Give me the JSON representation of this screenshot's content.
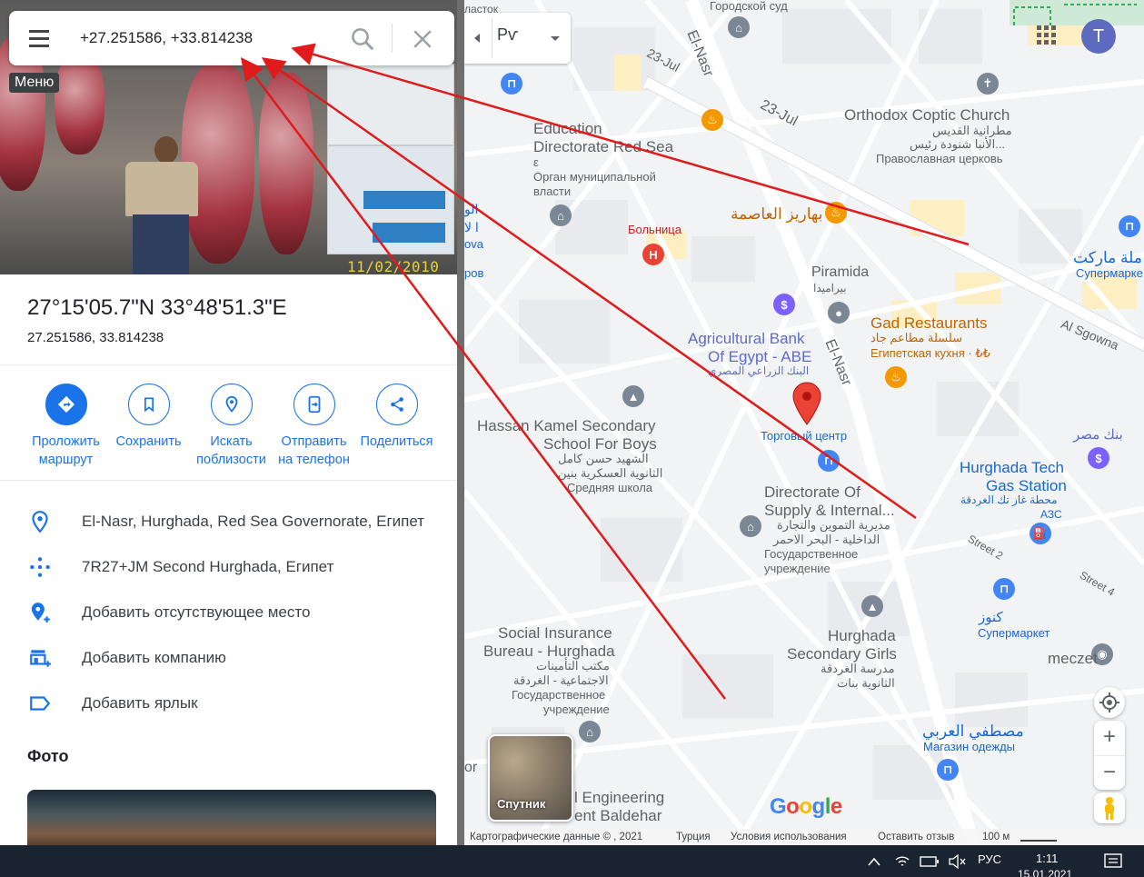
{
  "search": {
    "query": "+27.251586, +33.814238",
    "menu_tooltip": "Меню"
  },
  "hero": {
    "date_stamp": "11/02/2010"
  },
  "place": {
    "title": "27°15'05.7\"N 33°48'51.3\"E",
    "subtitle": "27.251586, 33.814238"
  },
  "actions": [
    {
      "label_line1": "Проложить",
      "label_line2": "маршрут",
      "icon": "directions-icon"
    },
    {
      "label_line1": "Сохранить",
      "label_line2": "",
      "icon": "bookmark-icon"
    },
    {
      "label_line1": "Искать",
      "label_line2": "поблизости",
      "icon": "nearby-icon"
    },
    {
      "label_line1": "Отправить",
      "label_line2": "на телефон",
      "icon": "send-to-phone-icon"
    },
    {
      "label_line1": "Поделиться",
      "label_line2": "",
      "icon": "share-icon"
    }
  ],
  "info": [
    {
      "text": "El-Nasr, Hurghada, Red Sea Governorate, Египет",
      "icon": "location-pin-icon"
    },
    {
      "text": "7R27+JM Second Hurghada, Египет",
      "icon": "plus-code-icon"
    },
    {
      "text": "Добавить отсутствующее место",
      "icon": "add-place-icon"
    },
    {
      "text": "Добавить компанию",
      "icon": "add-business-icon"
    },
    {
      "text": "Добавить ярлык",
      "icon": "label-icon"
    }
  ],
  "photos_title": "Фото",
  "map": {
    "lang_button": "Рѵ",
    "avatar_letter": "T",
    "satellite_label": "Спутник",
    "google_letters": [
      "G",
      "o",
      "o",
      "g",
      "l",
      "e"
    ],
    "google_colors": [
      "#4285f4",
      "#ea4335",
      "#fbbc05",
      "#4285f4",
      "#34a853",
      "#ea4335"
    ],
    "labels": {
      "gorodskoy_sud": "Городской суд",
      "hastok": "ласток",
      "zov": "зов",
      "road_23jul_a": "23-Jul",
      "road_23jul_b": "23-Jul",
      "road_elnasr_a": "El-Nasr",
      "road_elnasr_b": "El-Nasr",
      "orthodox_1": "Orthodox Coptic Church",
      "orthodox_2": "مطرانية القديس",
      "orthodox_3": "الأنبا شنودة رئيس...",
      "orthodox_4": "Православная церковь",
      "edu_1": "Education",
      "edu_2": "Directorate Red Sea",
      "edu_3": "ε",
      "edu_4": "Орган муниципальной",
      "edu_5": "власти",
      "bahariz": "بهاريز العاصمة",
      "hospital": "Больница",
      "piramida_1": "Piramida",
      "piramida_2": "بيراميدا",
      "gad_1": "Gad Restaurants",
      "gad_2": "سلسلة مطاعم جاد",
      "gad_3": "Египетская кухня · ₺₺",
      "market_ar": "ملة ماركت",
      "market_ru": "Супермарке",
      "al_sgowna": "Al Sgowna",
      "agri_1": "Agricultural Bank",
      "agri_2": "Of Egypt - ABE",
      "agri_3": "البنك الزراعي المصري",
      "mall": "Торговый центр",
      "hassan_1": "Hassan Kamel Secondary",
      "hassan_2": "School For Boys",
      "hassan_3": "الشهيد حسن كامل",
      "hassan_4": "الثانوية العسكرية بنين",
      "hassan_5": "Средняя школа",
      "bank_misr": "بنك مصر",
      "tech_1": "Hurghada Tech",
      "tech_2": "Gas Station",
      "tech_3": "محطة غاز تك الغردقة",
      "tech_4": "АЗС",
      "supply_1": "Directorate Of",
      "supply_2": "Supply & Internal...",
      "supply_3": "مديرية التموين والتجارة",
      "supply_4": "الداخلية - البحر الاحمر",
      "supply_5": "Государственное",
      "supply_6": "учреждение",
      "street2": "Street 2",
      "street4": "Street 4",
      "konoz_1": "كنوز",
      "konoz_2": "Супермаркет",
      "meczet": "meczet",
      "social_1": "Social Insurance",
      "social_2": "Bureau - Hurghada",
      "social_3": "مكتب التأمينات",
      "social_4": "الاجتماعية - الغردقة",
      "social_5": "Государственное",
      "social_6": "учреждение",
      "girls_1": "Hurghada",
      "girls_2": "Secondary Girls",
      "girls_3": "مدرسة الغردقة",
      "girls_4": "الثانوية بنات",
      "mostafa_1": "مصطفي العربي",
      "mostafa_2": "Магазин одежды",
      "engineering_1": "l Engineering",
      "engineering_2": "ent Baldehar",
      "left_or": "or",
      "left_ar1": "الو",
      "left_ar2": "ا لا",
      "left_ar3": "ova",
      "left_ar4": "ров"
    },
    "attribution": {
      "data": "Картографические данные © , 2021",
      "country": "Турция",
      "terms": "Условия использования",
      "feedback": "Оставить отзыв",
      "scale": "100 м"
    }
  },
  "taskbar": {
    "lang": "РУС",
    "time": "1:11",
    "date": "15.01.2021"
  }
}
